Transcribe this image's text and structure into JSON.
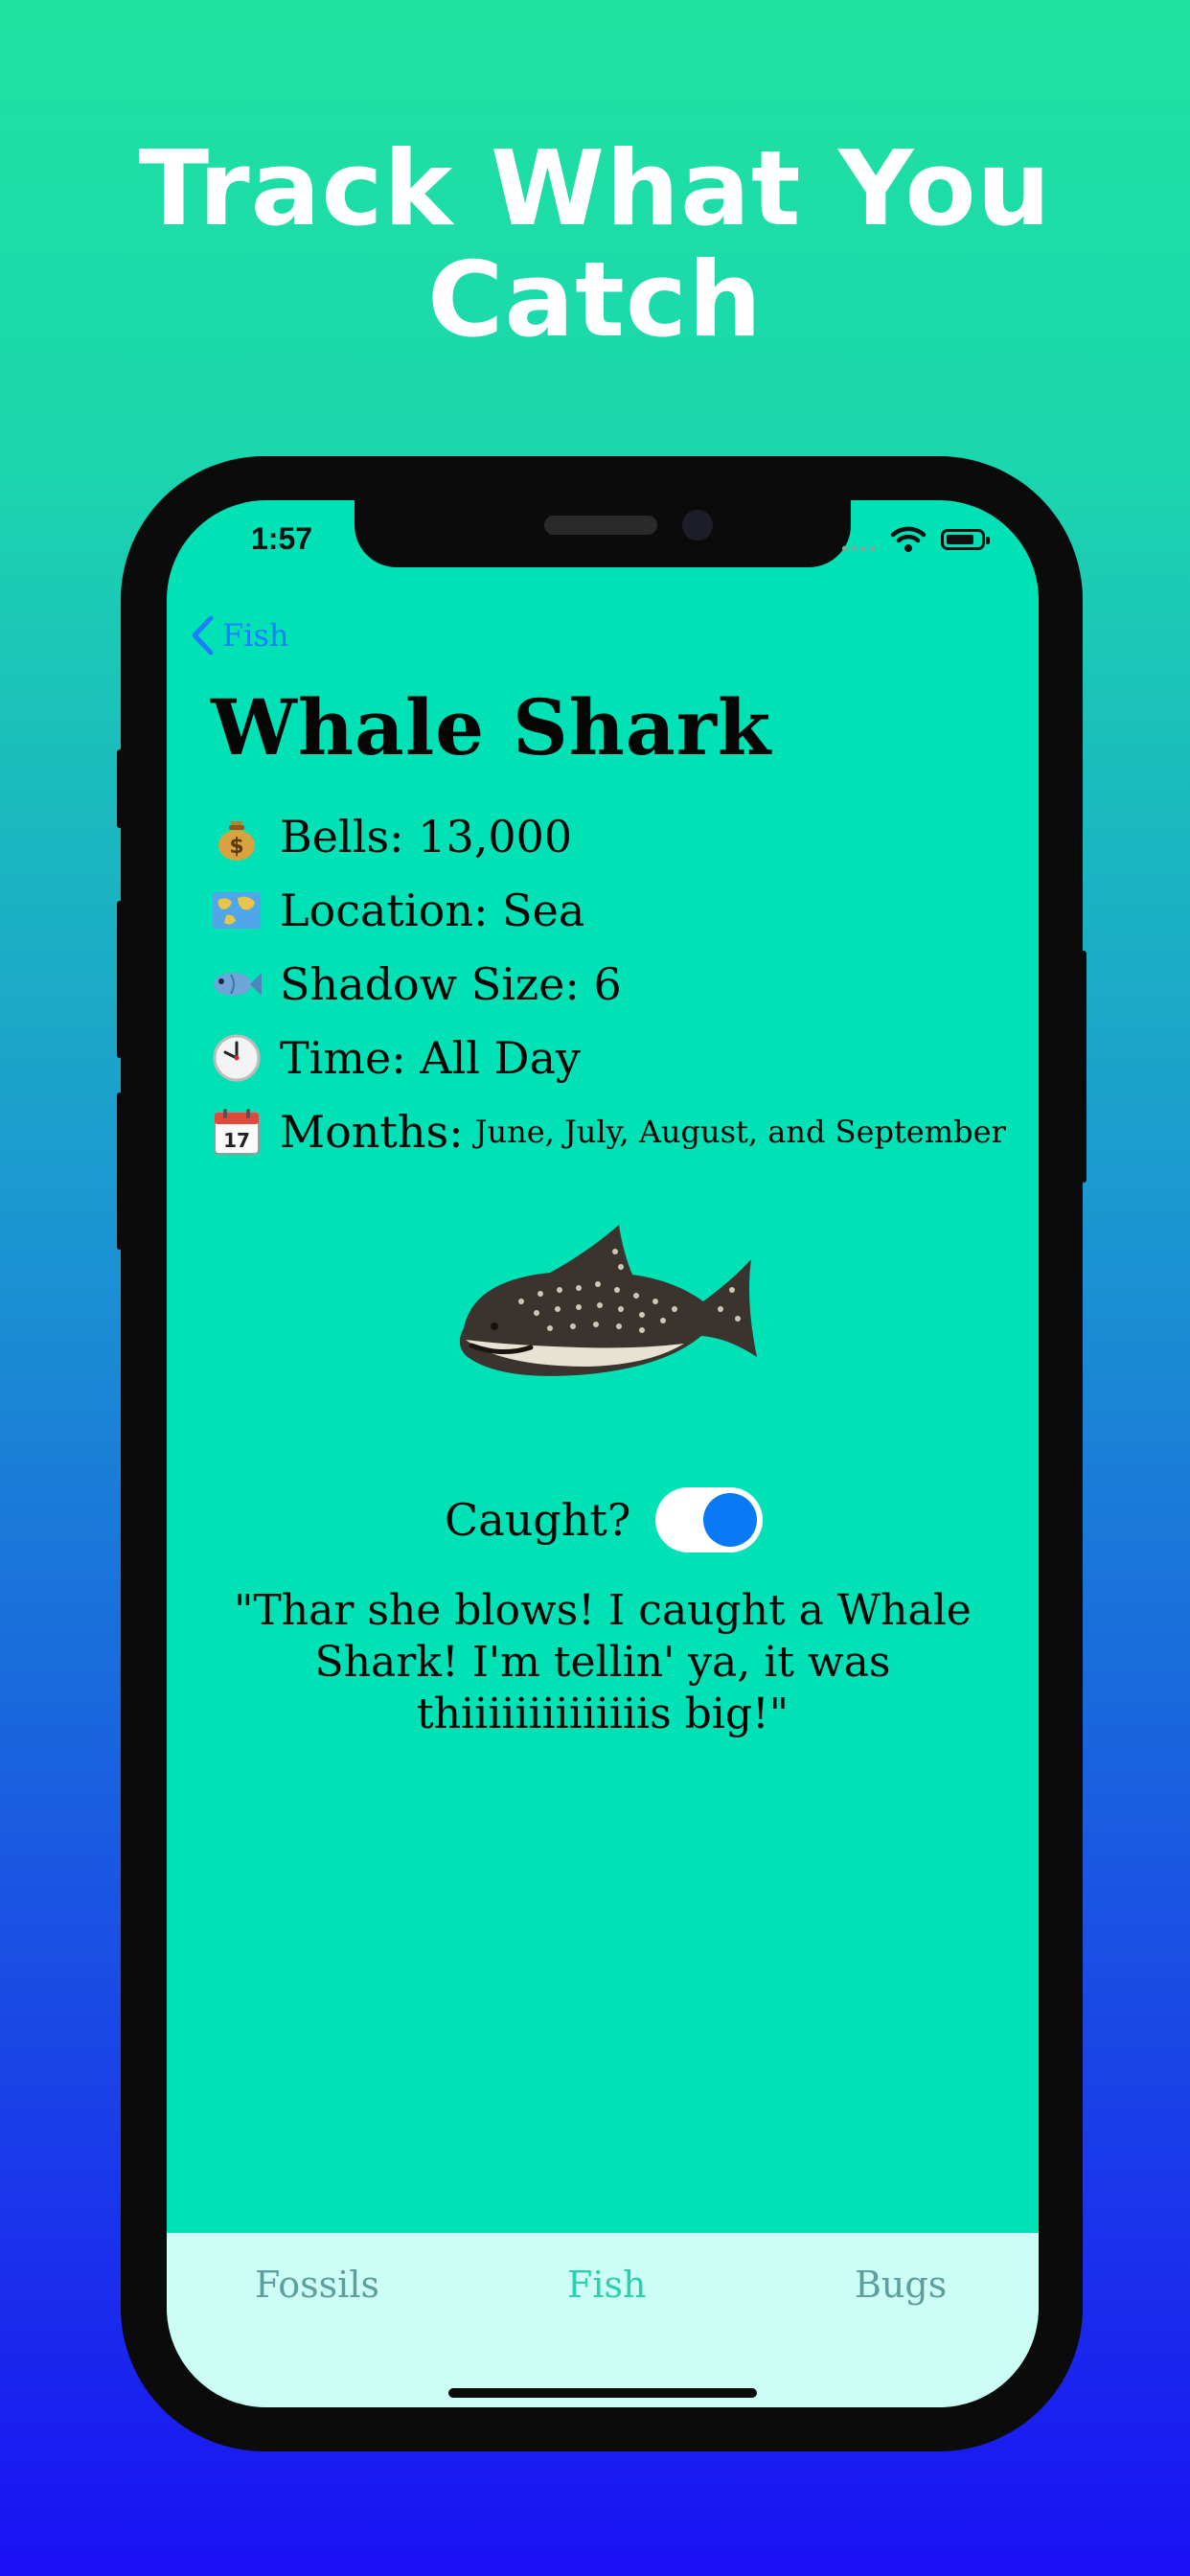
{
  "promo": {
    "headline": "Track What You Catch"
  },
  "status_bar": {
    "time": "1:57"
  },
  "nav": {
    "back_label": "Fish"
  },
  "detail": {
    "name": "Whale Shark",
    "facts": [
      {
        "icon": "money-bag-icon",
        "label": "Bells:",
        "value": "13,000"
      },
      {
        "icon": "world-map-icon",
        "label": "Location:",
        "value": "Sea"
      },
      {
        "icon": "fish-icon",
        "label": "Shadow Size:",
        "value": "6"
      },
      {
        "icon": "clock-icon",
        "label": "Time:",
        "value": "All Day"
      },
      {
        "icon": "calendar-icon",
        "label": "Months:",
        "value": "June, July, August, and September"
      }
    ],
    "caught_label": "Caught?",
    "caught": true,
    "quote": "\"Thar she blows! I caught a Whale Shark! I'm tellin' ya, it was thiiiiiiiiiiiiiis big!\""
  },
  "tabs": [
    {
      "label": "Fossils",
      "active": false
    },
    {
      "label": "Fish",
      "active": true
    },
    {
      "label": "Bugs",
      "active": false
    }
  ],
  "colors": {
    "screen_bg": "#00e2b5",
    "tabbar_bg": "#ccfef5",
    "active_tab": "#2ccfae",
    "inactive_tab": "#5d9f9e",
    "toggle_on": "#0a79f5",
    "link": "#1f7dff"
  }
}
